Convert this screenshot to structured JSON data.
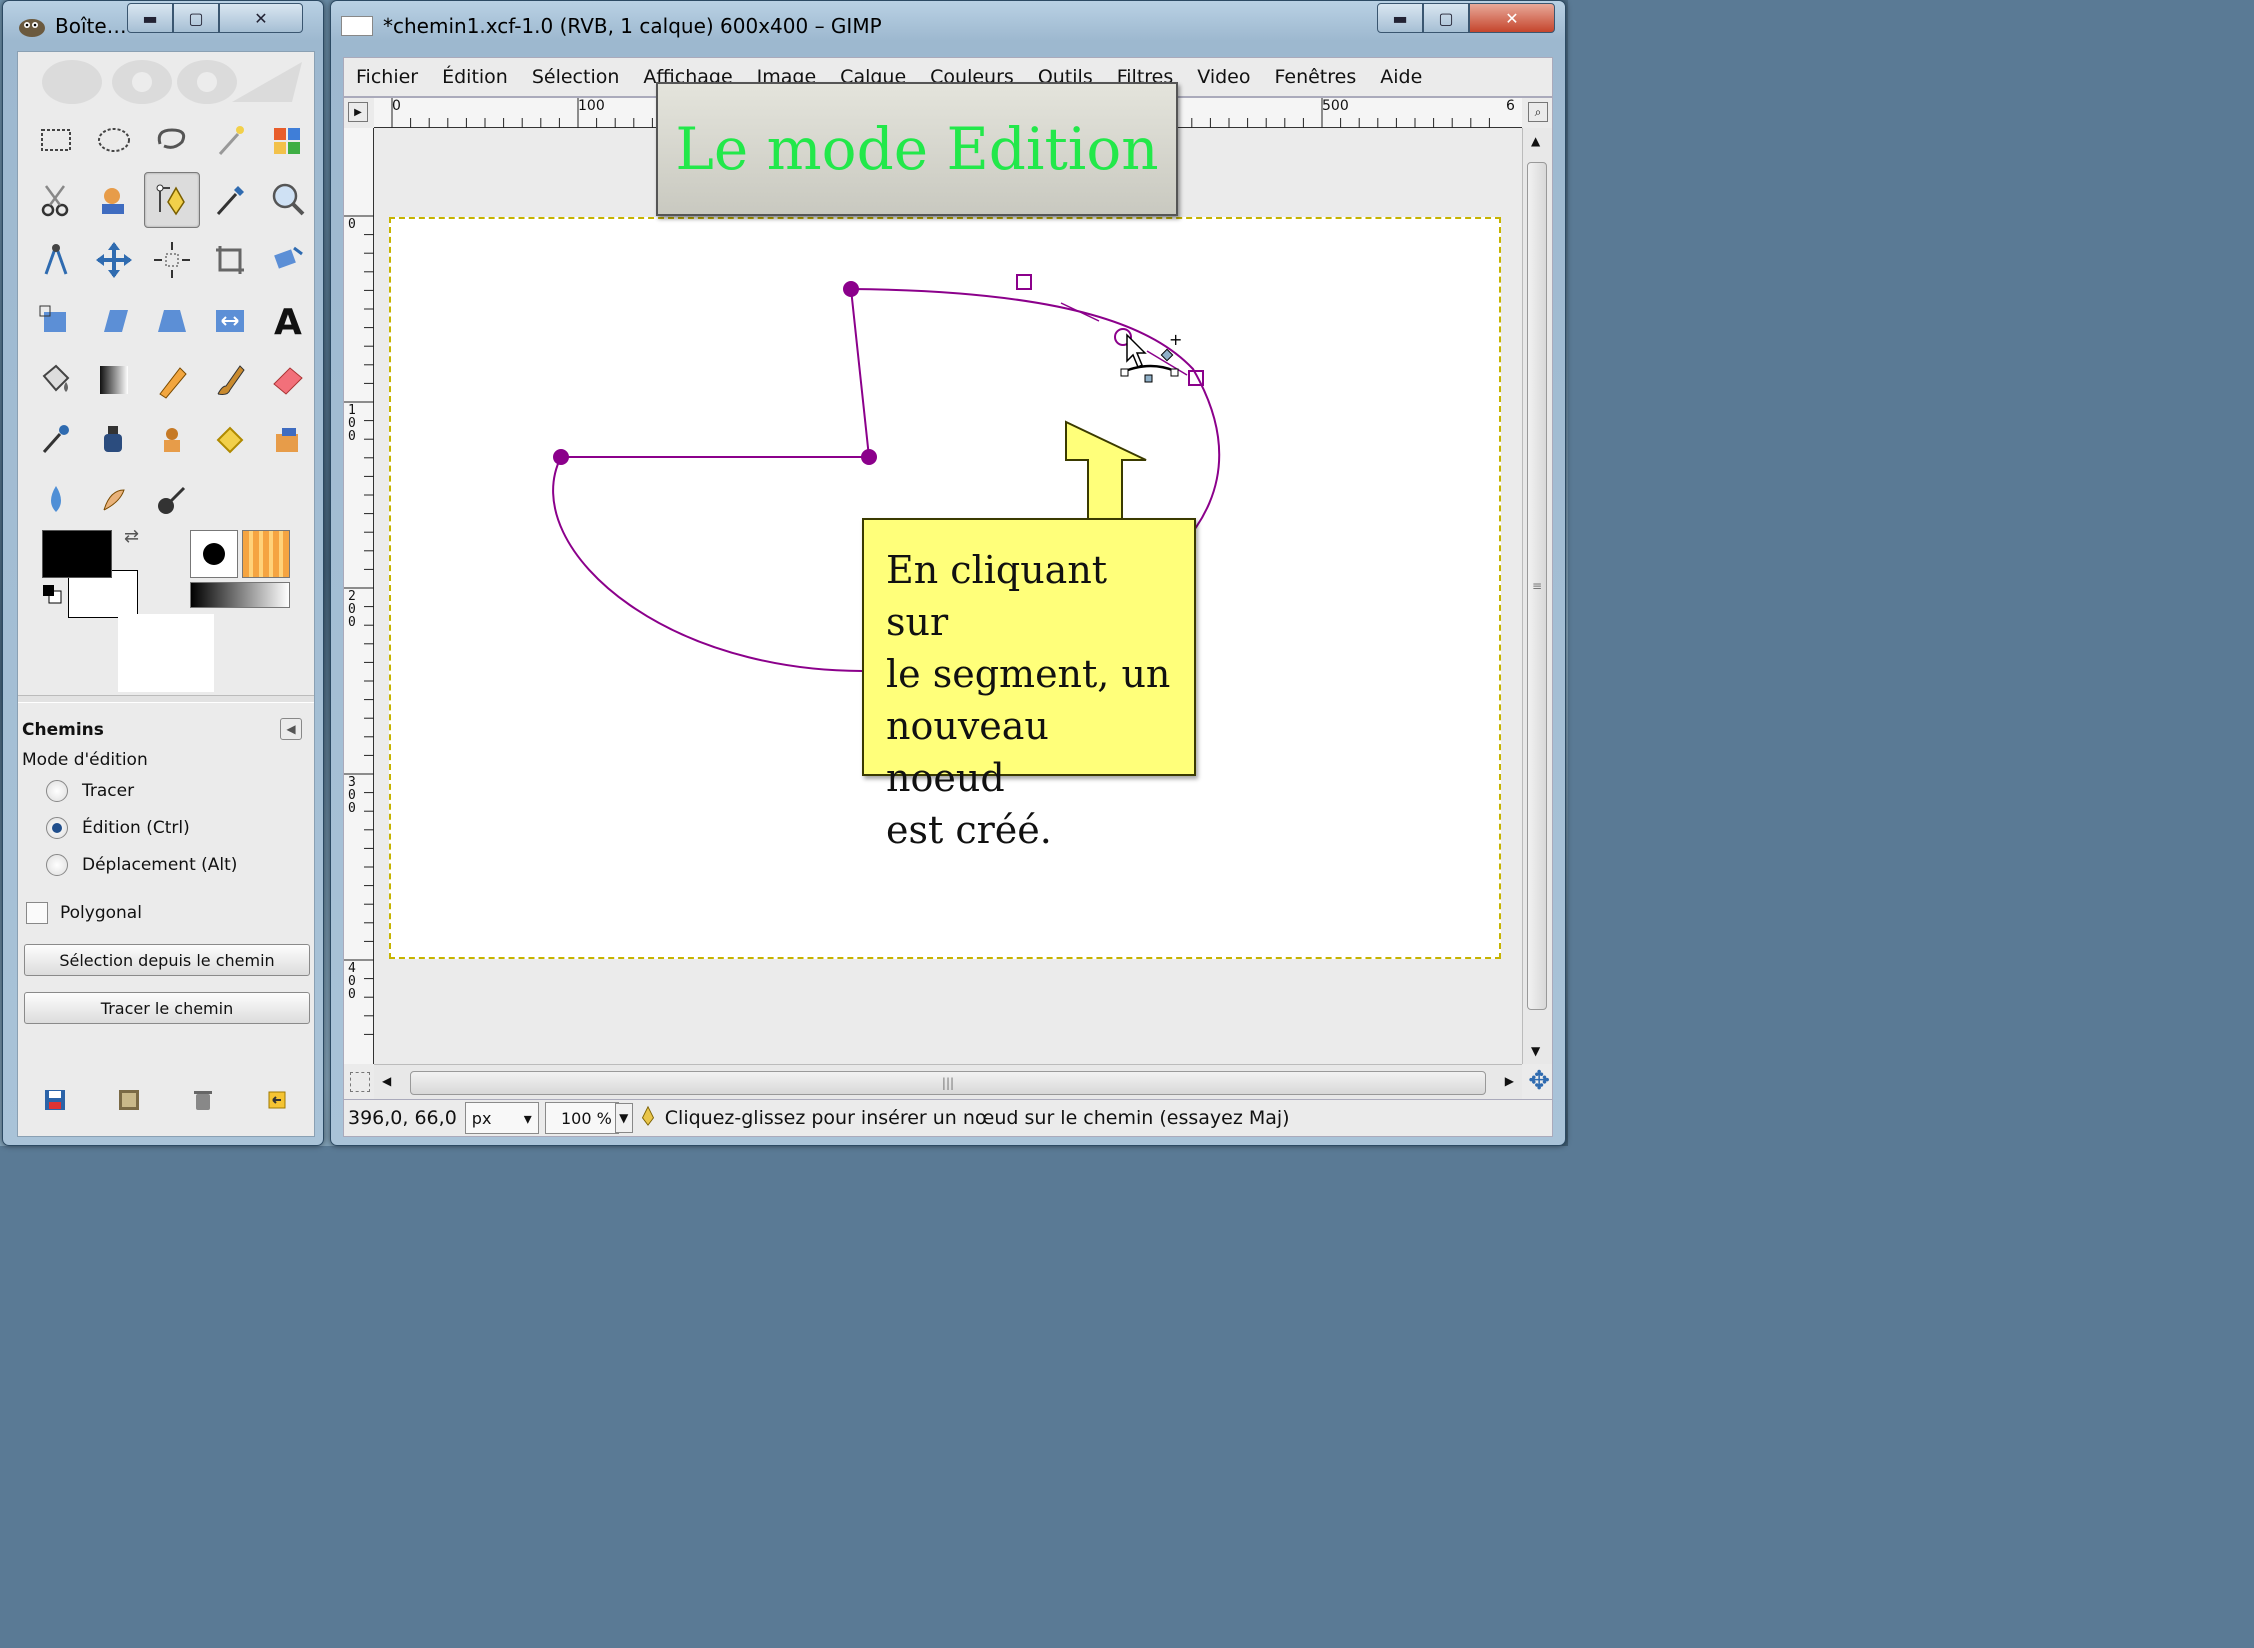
{
  "toolbox": {
    "title": "Boîte…",
    "tools": [
      "rect-select",
      "ellipse-select",
      "free-select",
      "fuzzy-select",
      "color-select",
      "scissors",
      "foreground-select",
      "paths",
      "color-picker",
      "zoom",
      "measure",
      "move",
      "align",
      "crop",
      "rotate",
      "scale",
      "shear",
      "perspective",
      "flip",
      "text",
      "bucket-fill",
      "blend",
      "pencil",
      "paintbrush",
      "eraser",
      "airbrush",
      "ink",
      "clone",
      "heal",
      "perspective-clone",
      "blur",
      "smudge",
      "dodge-burn"
    ],
    "active_tool": "paths",
    "fg_color": "#000000",
    "bg_color": "#ffffff",
    "options": {
      "title": "Chemins",
      "mode_label": "Mode d'édition",
      "modes": [
        "Tracer",
        "Édition (Ctrl)",
        "Déplacement (Alt)"
      ],
      "selected_mode": 1,
      "polygonal_label": "Polygonal",
      "btn_selection": "Sélection depuis le chemin",
      "btn_trace": "Tracer le chemin"
    }
  },
  "image_window": {
    "title": "*chemin1.xcf-1.0 (RVB, 1 calque) 600x400 – GIMP",
    "menu": [
      "Fichier",
      "Édition",
      "Sélection",
      "Affichage",
      "Image",
      "Calque",
      "Couleurs",
      "Outils",
      "Filtres",
      "Video",
      "Fenêtres",
      "Aide"
    ],
    "ruler_h": [
      "0",
      "100",
      "500",
      "6"
    ],
    "ruler_v": [
      "0",
      "100",
      "200",
      "300",
      "400"
    ],
    "status": {
      "coords": "396,0, 66,0",
      "unit": "px",
      "zoom": "100 %",
      "message": "Cliquez-glissez pour insérer un nœud sur le chemin (essayez Maj)"
    }
  },
  "overlay": {
    "banner_text": "Le mode Edition",
    "banner_color": "#22e84a",
    "callout_lines": [
      "En cliquant sur",
      "le segment, un",
      "nouveau noeud",
      "est créé."
    ],
    "callout_color": "#ffff7a"
  },
  "path_color": "#8b008b"
}
